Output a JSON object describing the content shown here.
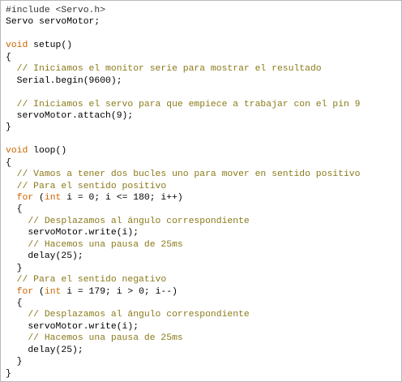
{
  "editor": {
    "language": "Arduino C++",
    "colors": {
      "background": "#ffffff",
      "border": "#b8b8b8",
      "text": "#000000",
      "keyword": "#cc6600",
      "comment": "#8a7a1a"
    },
    "lines": [
      [
        {
          "t": "#include <Servo.h>",
          "c": "preproc"
        }
      ],
      [
        {
          "t": "Servo servoMotor;",
          "c": "default"
        }
      ],
      [],
      [
        {
          "t": "void",
          "c": "keyword"
        },
        {
          "t": " setup()",
          "c": "default"
        }
      ],
      [
        {
          "t": "{",
          "c": "default"
        }
      ],
      [
        {
          "t": "  // Iniciamos el monitor serie para mostrar el resultado",
          "c": "comment"
        }
      ],
      [
        {
          "t": "  Serial.begin(9600);",
          "c": "default"
        }
      ],
      [],
      [
        {
          "t": "  // Iniciamos el servo para que empiece a trabajar con el pin 9",
          "c": "comment"
        }
      ],
      [
        {
          "t": "  servoMotor.attach(9);",
          "c": "default"
        }
      ],
      [
        {
          "t": "}",
          "c": "default"
        }
      ],
      [],
      [
        {
          "t": "void",
          "c": "keyword"
        },
        {
          "t": " loop()",
          "c": "default"
        }
      ],
      [
        {
          "t": "{",
          "c": "default"
        }
      ],
      [
        {
          "t": "  // Vamos a tener dos bucles uno para mover en sentido positivo",
          "c": "comment"
        }
      ],
      [
        {
          "t": "  // Para el sentido positivo",
          "c": "comment"
        }
      ],
      [
        {
          "t": "  ",
          "c": "default"
        },
        {
          "t": "for",
          "c": "keyword"
        },
        {
          "t": " (",
          "c": "default"
        },
        {
          "t": "int",
          "c": "type"
        },
        {
          "t": " i = 0; i <= 180; i++)",
          "c": "default"
        }
      ],
      [
        {
          "t": "  {",
          "c": "default"
        }
      ],
      [
        {
          "t": "    // Desplazamos al ángulo correspondiente",
          "c": "comment"
        }
      ],
      [
        {
          "t": "    servoMotor.write(i);",
          "c": "default"
        }
      ],
      [
        {
          "t": "    // Hacemos una pausa de 25ms",
          "c": "comment"
        }
      ],
      [
        {
          "t": "    delay(25);",
          "c": "default"
        }
      ],
      [
        {
          "t": "  }",
          "c": "default"
        }
      ],
      [
        {
          "t": "  // Para el sentido negativo",
          "c": "comment"
        }
      ],
      [
        {
          "t": "  ",
          "c": "default"
        },
        {
          "t": "for",
          "c": "keyword"
        },
        {
          "t": " (",
          "c": "default"
        },
        {
          "t": "int",
          "c": "type"
        },
        {
          "t": " i = 179; i > 0; i--)",
          "c": "default"
        }
      ],
      [
        {
          "t": "  {",
          "c": "default"
        }
      ],
      [
        {
          "t": "    // Desplazamos al ángulo correspondiente",
          "c": "comment"
        }
      ],
      [
        {
          "t": "    servoMotor.write(i);",
          "c": "default"
        }
      ],
      [
        {
          "t": "    // Hacemos una pausa de 25ms",
          "c": "comment"
        }
      ],
      [
        {
          "t": "    delay(25);",
          "c": "default"
        }
      ],
      [
        {
          "t": "  }",
          "c": "default"
        }
      ],
      [
        {
          "t": "}",
          "c": "default"
        }
      ]
    ]
  }
}
